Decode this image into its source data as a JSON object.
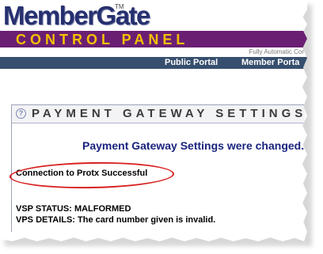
{
  "header": {
    "logo_text": "MemberGate",
    "tm": "TM",
    "banner_title": "CONTROL PANEL",
    "tagline": "Fully Automatic Cor"
  },
  "nav": {
    "items": [
      {
        "label": "Public Portal"
      },
      {
        "label": "Member Porta"
      }
    ]
  },
  "panel": {
    "help_icon": "?",
    "title": "PAYMENT GATEWAY SETTINGS",
    "changed_message": "Payment Gateway Settings were changed.",
    "connection_message": "Connection to Protx Successful",
    "vsp_status": "VSP STATUS: MALFORMED",
    "vps_details": "VPS DETAILS: The card number given is invalid."
  },
  "colors": {
    "logo": "#26306f",
    "banner_bg": "#6a1f73",
    "banner_text": "#f5c000",
    "nav_bg": "#374f6e",
    "message": "#1a237e",
    "highlight_oval": "#d82020"
  }
}
